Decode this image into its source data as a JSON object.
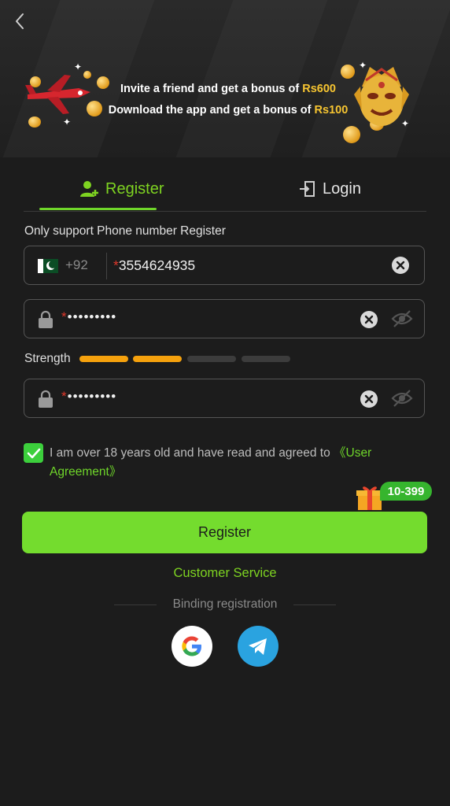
{
  "banner": {
    "line1_text": "Invite a friend and get a bonus of ",
    "line1_amount": "Rs600",
    "line2_text": "Download the app and get a bonus of ",
    "line2_amount": "Rs100"
  },
  "tabs": [
    {
      "label": "Register",
      "active": true
    },
    {
      "label": "Login",
      "active": false
    }
  ],
  "form": {
    "hint": "Only support Phone number Register",
    "country_code": "+92",
    "required_mark": "*",
    "phone_value": "3554624935",
    "password_value": "•••••••••",
    "confirm_value": "•••••••••",
    "strength_label": "Strength",
    "strength_level": 2,
    "strength_total": 4,
    "agreement_checked": true,
    "agreement_text": "I am over 18 years old and have read and agreed to ",
    "agreement_link": "《User Agreement》"
  },
  "bonus_badge": "10-399",
  "register_button": "Register",
  "customer_service": "Customer Service",
  "binding_label": "Binding registration",
  "social": [
    "google-icon",
    "telegram-icon"
  ],
  "colors": {
    "accent": "#74dc2e",
    "strength_on": "#f5a10d",
    "strength_off": "#3c3c3c",
    "background": "#1c1c1c"
  }
}
